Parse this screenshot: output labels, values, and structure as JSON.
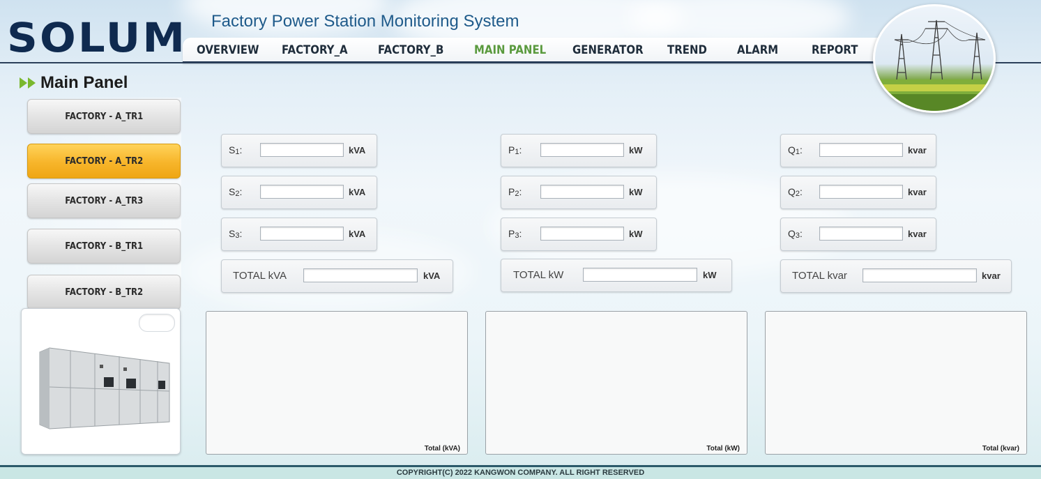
{
  "brand": {
    "logo": "SOLUM",
    "app_title": "Factory Power Station Monitoring System"
  },
  "nav": {
    "items": [
      {
        "label": "OVERVIEW",
        "active": false
      },
      {
        "label": "FACTORY_A",
        "active": false
      },
      {
        "label": "FACTORY_B",
        "active": false
      },
      {
        "label": "MAIN PANEL",
        "active": true
      },
      {
        "label": "GENERATOR",
        "active": false
      },
      {
        "label": "TREND",
        "active": false
      },
      {
        "label": "ALARM",
        "active": false
      },
      {
        "label": "REPORT",
        "active": false
      }
    ]
  },
  "page": {
    "title": "Main Panel"
  },
  "sidebar": {
    "items": [
      {
        "label": "FACTORY - A_TR1",
        "active": false
      },
      {
        "label": "FACTORY - A_TR2",
        "active": true
      },
      {
        "label": "FACTORY - A_TR3",
        "active": false
      },
      {
        "label": "FACTORY - B_TR1",
        "active": false
      },
      {
        "label": "FACTORY - B_TR2",
        "active": false
      }
    ]
  },
  "measurements": {
    "apparent": {
      "rows": [
        {
          "label": "S",
          "sub": "1",
          "suffix": ":",
          "value": "",
          "unit": "kVA"
        },
        {
          "label": "S",
          "sub": "2",
          "suffix": ":",
          "value": "",
          "unit": "kVA"
        },
        {
          "label": "S",
          "sub": "3",
          "suffix": ":",
          "value": "",
          "unit": "kVA"
        }
      ],
      "total": {
        "label": "TOTAL kVA",
        "value": "",
        "unit": "kVA"
      }
    },
    "active": {
      "rows": [
        {
          "label": "P",
          "sub": "1",
          "suffix": ":",
          "value": "",
          "unit": "kW"
        },
        {
          "label": "P",
          "sub": "2",
          "suffix": ":",
          "value": "",
          "unit": "kW"
        },
        {
          "label": "P",
          "sub": "3",
          "suffix": ":",
          "value": "",
          "unit": "kW"
        }
      ],
      "total": {
        "label": "TOTAL kW",
        "value": "",
        "unit": "kW"
      }
    },
    "reactive": {
      "rows": [
        {
          "label": "Q",
          "sub": "1",
          "suffix": ":",
          "value": "",
          "unit": "kvar"
        },
        {
          "label": "Q",
          "sub": "2",
          "suffix": ":",
          "value": "",
          "unit": "kvar"
        },
        {
          "label": "Q",
          "sub": "3",
          "suffix": ":",
          "value": "",
          "unit": "kvar"
        }
      ],
      "total": {
        "label": "TOTAL kvar",
        "value": "",
        "unit": "kvar"
      }
    }
  },
  "charts": {
    "kva_caption": "Total (kVA)",
    "kw_caption": "Total (kW)",
    "kvar_caption": "Total (kvar)"
  },
  "footer": {
    "copyright": "COPYRIGHT(C) 2022 KANGWON COMPANY. ALL RIGHT RESERVED"
  },
  "colors": {
    "accent": "#5a9a3e",
    "active_button": "#f7b52a",
    "navy": "#0f2a4f"
  }
}
